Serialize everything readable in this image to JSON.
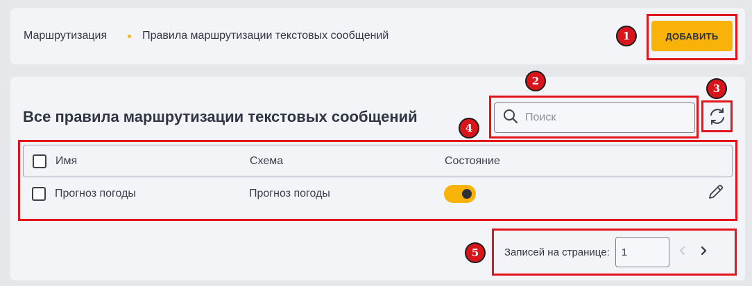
{
  "header": {
    "breadcrumb": [
      "Маршрутизация",
      "Правила маршрутизации текстовых сообщений"
    ],
    "add_button_label": "ДОБАВИТЬ"
  },
  "main": {
    "title": "Все правила маршрутизации текстовых сообщений",
    "search": {
      "placeholder": "Поиск",
      "value": ""
    },
    "refresh_icon": "refresh-icon",
    "table": {
      "columns": [
        "Имя",
        "Схема",
        "Состояние"
      ],
      "rows": [
        {
          "name": "Прогноз погоды",
          "scheme": "Прогноз погоды",
          "state_on": true
        }
      ]
    },
    "pagination": {
      "label": "Записей на странице:",
      "value": "1"
    }
  },
  "annotations": [
    "1",
    "2",
    "3",
    "4",
    "5"
  ],
  "colors": {
    "accent": "#f9b308",
    "annotation": "#e1141b"
  }
}
